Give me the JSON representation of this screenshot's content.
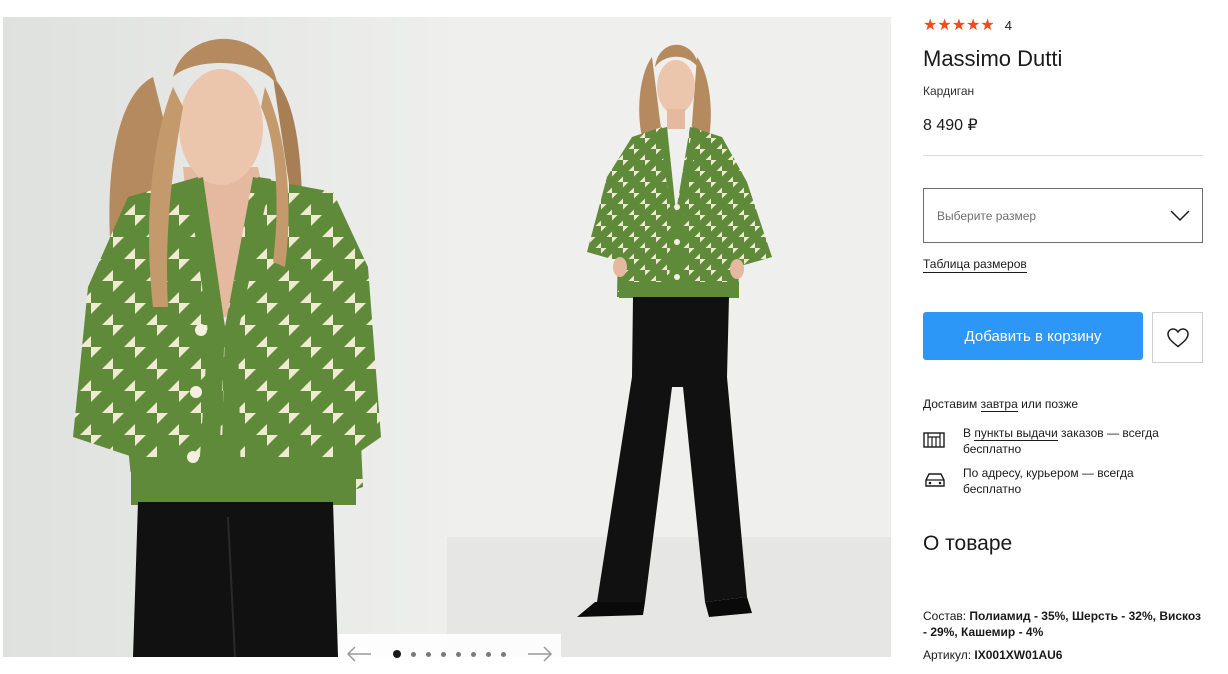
{
  "gallery": {
    "dots_total": 8,
    "active_dot": 1
  },
  "product": {
    "rating_stars": 5,
    "rating_count": "4",
    "brand": "Massimo Dutti",
    "category": "Кардиган",
    "price": "8 490 ₽"
  },
  "size": {
    "placeholder": "Выберите размер",
    "table_link": "Таблица размеров"
  },
  "actions": {
    "add_to_cart": "Добавить в корзину"
  },
  "delivery": {
    "prefix": "Доставим ",
    "when_link": "завтра",
    "suffix": " или позже",
    "pickup_prefix": "В ",
    "pickup_link": "пункты выдачи",
    "pickup_suffix": " заказов — всегда бесплатно",
    "courier": "По адресу, курьером — всегда бесплатно"
  },
  "about": {
    "title": "О товаре",
    "composition_label": "Состав: ",
    "composition_value": "Полиамид - 35%, Шерсть - 32%, Вискоз - 29%, Кашемир - 4%",
    "article_label": "Артикул: ",
    "article_value": "IX001XW01AU6"
  },
  "colors": {
    "accent": "#2c97f7",
    "stars": "#f24a1d",
    "garment_green": "#5f8a3a",
    "garment_cream": "#f0ead2"
  }
}
